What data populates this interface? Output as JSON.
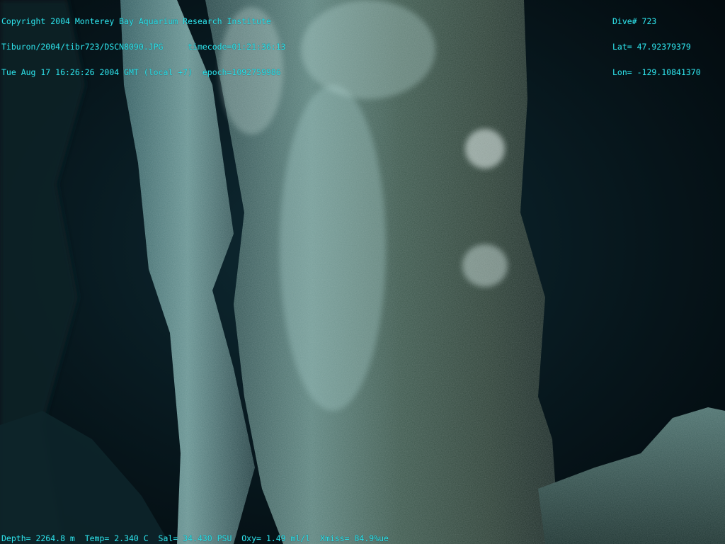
{
  "overlay": {
    "top_left": [
      "Copyright 2004 Monterey Bay Aquarium Research Institute",
      "Tiburon/2004/tibr723/DSCN8090.JPG     timecode=01:21:36:13",
      "Tue Aug 17 16:26:26 2004 GMT (local +7)  epoch=1092759986"
    ],
    "top_right": [
      "Dive# 723",
      "Lat= 47.92379379",
      "Lon= -129.10841370"
    ],
    "bottom": "Depth= 2264.8 m  Temp= 2.340 C  Sal= 34.430 PSU  Oxy= 1.49 ml/l  Xmiss= 84.9%ue"
  },
  "colors": {
    "overlay_text": "#2fe0e8",
    "background": "#05131a"
  }
}
